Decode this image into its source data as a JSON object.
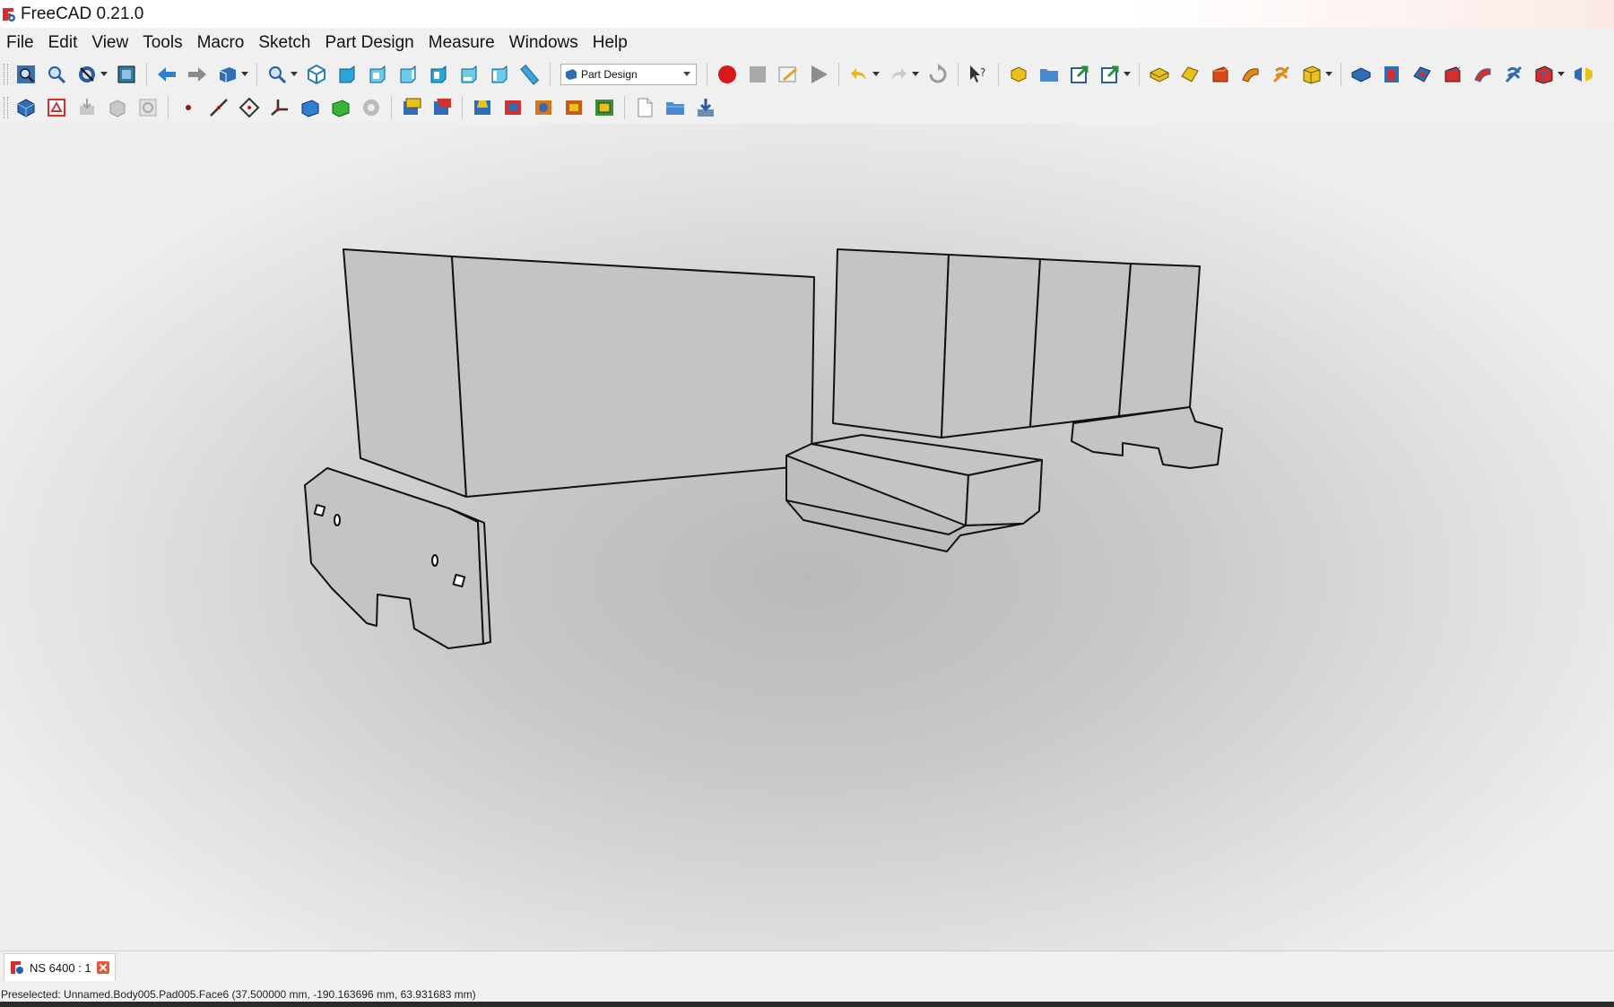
{
  "window": {
    "title": "FreeCAD 0.21.0"
  },
  "menu": [
    "File",
    "Edit",
    "View",
    "Tools",
    "Macro",
    "Sketch",
    "Part Design",
    "Measure",
    "Windows",
    "Help"
  ],
  "toolbar": {
    "workbench_selected": "Part Design",
    "icons_row1": [
      "fit-all-icon",
      "fit-selection-icon",
      "draw-style-icon",
      "bounding-box-icon",
      "back-arrow-icon",
      "forward-arrow-icon",
      "sync-view-icon",
      "zoom-icon",
      "isometric-view-icon",
      "front-view-icon",
      "top-view-icon",
      "right-view-icon",
      "rear-view-icon",
      "bottom-view-icon",
      "left-view-icon",
      "measure-distance-icon",
      "macro-record-icon",
      "macro-stop-icon",
      "macro-edit-icon",
      "macro-run-icon",
      "undo-icon",
      "redo-icon",
      "refresh-icon",
      "whats-this-icon",
      "create-body-icon",
      "create-part-icon",
      "link-icon",
      "link-actions-icon",
      "pad-icon",
      "revolution-icon",
      "loft-icon",
      "pipe-icon",
      "helix-icon",
      "additive-primitive-icon",
      "pocket-icon",
      "hole-icon",
      "groove-icon",
      "subtractive-loft-icon",
      "subtractive-pipe-icon",
      "subtractive-helix-icon",
      "subtractive-primitive-icon",
      "mirrored-icon"
    ],
    "icons_row2": [
      "body-icon",
      "new-sketch-icon",
      "attach-sketch-icon",
      "validate-sketch-icon",
      "check-geometry-icon",
      "datum-point-icon",
      "datum-line-icon",
      "datum-plane-icon",
      "local-cs-icon",
      "shape-binder-icon",
      "subshape-binder-icon",
      "clone-icon",
      "fillet-icon",
      "chamfer-icon",
      "draft-icon",
      "thickness-icon",
      "boolean-icon",
      "multitransform-icon",
      "linear-pattern-icon",
      "new-document-icon",
      "open-document-icon",
      "save-document-icon"
    ]
  },
  "document_tab": {
    "label": "NS 6400 : 1"
  },
  "status": {
    "text": "Preselected: Unnamed.Body005.Pad005.Face6 (37.500000 mm, -190.163696 mm, 63.931683 mm)"
  },
  "colors": {
    "viewport_center": "#b9b9b9",
    "viewport_edge": "#eeeeee",
    "model_edges": "#111111",
    "model_faces": "#c4c4c4",
    "tab_close": "#e35a3a"
  }
}
